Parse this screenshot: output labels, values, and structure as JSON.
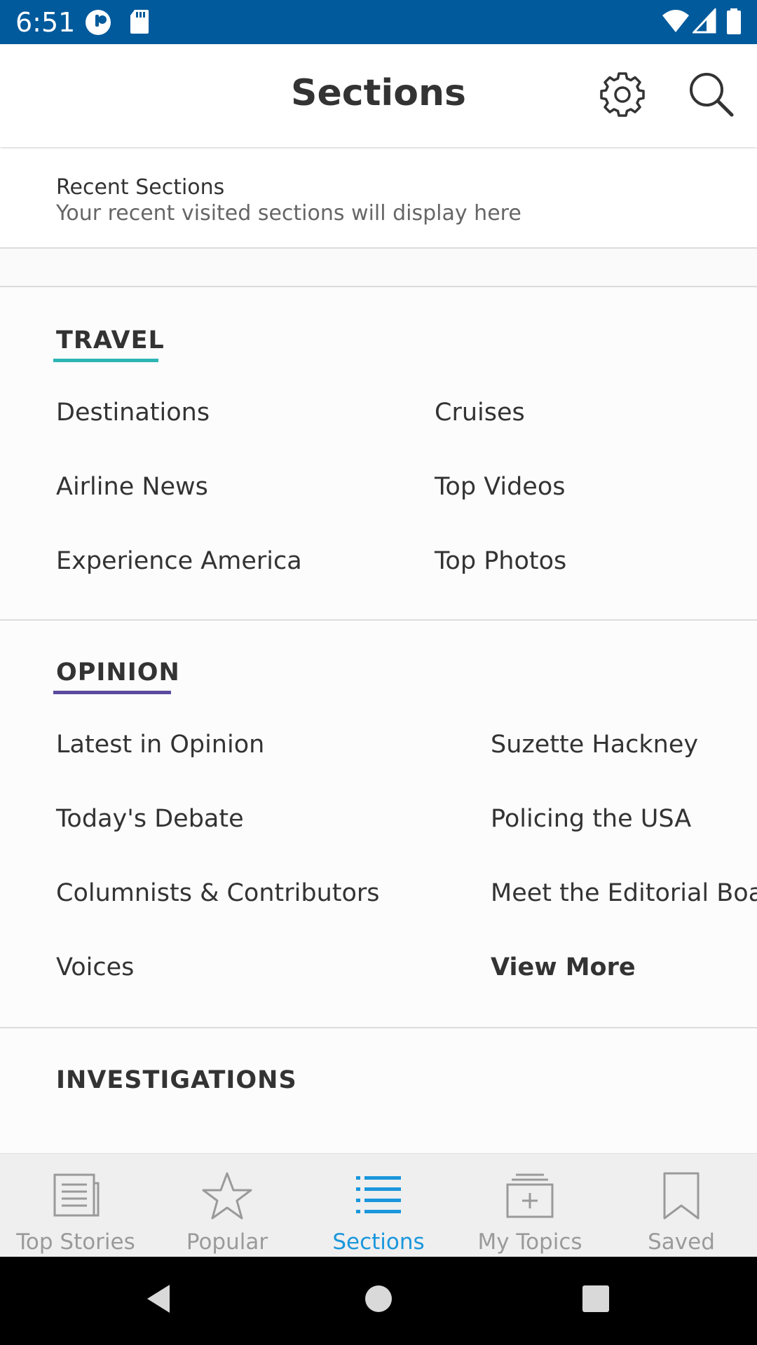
{
  "status_bar": {
    "time": "6:51"
  },
  "header": {
    "title": "Sections"
  },
  "recent": {
    "title": "Recent Sections",
    "subtitle": "Your recent visited sections will display here"
  },
  "travel": {
    "heading": "TRAVEL",
    "accent": "#2db5b5",
    "links": [
      "Destinations",
      "Cruises",
      "Airline News",
      "Top Videos",
      "Experience America",
      "Top Photos"
    ]
  },
  "opinion": {
    "heading": "OPINION",
    "accent": "#5b4a9e",
    "links": [
      "Latest in Opinion",
      "Suzette Hackney",
      "Today's Debate",
      "Policing the USA",
      "Columnists & Contributors",
      "Meet the Editorial Board",
      "Voices"
    ],
    "view_more": "View More"
  },
  "investigations": {
    "heading": "INVESTIGATIONS"
  },
  "bottom_nav": {
    "tabs": [
      {
        "label": "Top Stories",
        "icon": "newspaper-icon"
      },
      {
        "label": "Popular",
        "icon": "star-icon"
      },
      {
        "label": "Sections",
        "icon": "list-icon",
        "active": true
      },
      {
        "label": "My Topics",
        "icon": "add-topic-icon"
      },
      {
        "label": "Saved",
        "icon": "bookmark-icon"
      }
    ],
    "active_color": "#1a97dc",
    "inactive_color": "#9a9a9a"
  }
}
